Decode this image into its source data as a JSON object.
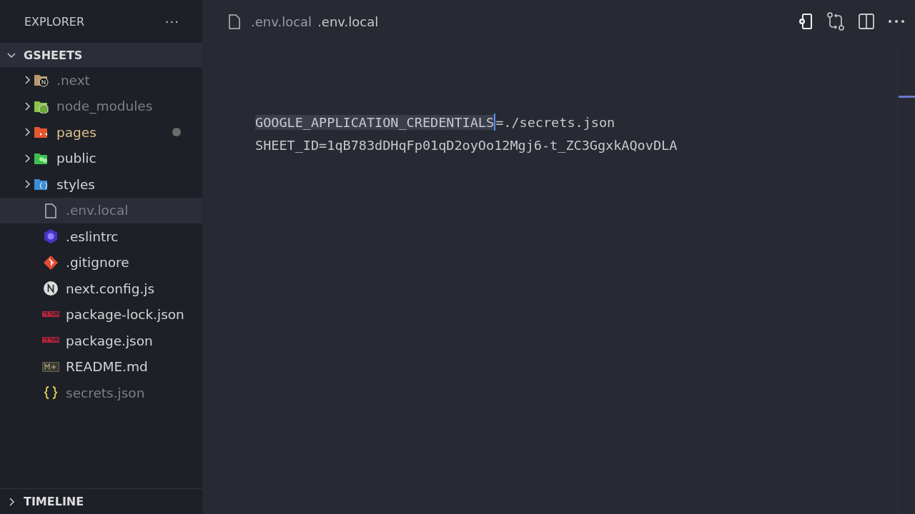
{
  "sidebar": {
    "title": "EXPLORER",
    "more": "···",
    "root": {
      "label": "GSHEETS",
      "expanded": true
    },
    "items": [
      {
        "label": ".next",
        "kind": "folder",
        "expanded": false,
        "selected": false,
        "ignored": true,
        "modified": false
      },
      {
        "label": "node_modules",
        "kind": "folder",
        "expanded": false,
        "selected": false,
        "ignored": true,
        "modified": false
      },
      {
        "label": "pages",
        "kind": "folder",
        "expanded": false,
        "selected": false,
        "ignored": false,
        "modified": true
      },
      {
        "label": "public",
        "kind": "folder",
        "expanded": false,
        "selected": false,
        "ignored": false,
        "modified": false
      },
      {
        "label": "styles",
        "kind": "folder",
        "expanded": false,
        "selected": false,
        "ignored": false,
        "modified": false
      },
      {
        "label": ".env.local",
        "kind": "file",
        "selected": true,
        "ignored": true,
        "modified": false
      },
      {
        "label": ".eslintrc",
        "kind": "file",
        "selected": false,
        "ignored": false,
        "modified": false
      },
      {
        "label": ".gitignore",
        "kind": "file",
        "selected": false,
        "ignored": false,
        "modified": false
      },
      {
        "label": "next.config.js",
        "kind": "file",
        "selected": false,
        "ignored": false,
        "modified": false
      },
      {
        "label": "package-lock.json",
        "kind": "file",
        "selected": false,
        "ignored": false,
        "modified": false
      },
      {
        "label": "package.json",
        "kind": "file",
        "selected": false,
        "ignored": false,
        "modified": false
      },
      {
        "label": "README.md",
        "kind": "file",
        "selected": false,
        "ignored": false,
        "modified": false
      },
      {
        "label": "secrets.json",
        "kind": "file",
        "selected": false,
        "ignored": true,
        "modified": false
      }
    ],
    "timeline": {
      "label": "TIMELINE",
      "expanded": false
    }
  },
  "tab": {
    "title": ".env.local",
    "description": ".env.local"
  },
  "editor": {
    "lines": [
      [
        {
          "text": "GOOGLE_APPLICATION_CREDENTIALS",
          "selected": true
        },
        {
          "text": "=./secrets.json",
          "selected": false
        }
      ],
      [
        {
          "text": "SHEET_ID=1qB783dDHqFp01qD2oyOo12Mgj6-t_ZC3GgxkAQovDLA",
          "selected": false
        }
      ]
    ]
  }
}
